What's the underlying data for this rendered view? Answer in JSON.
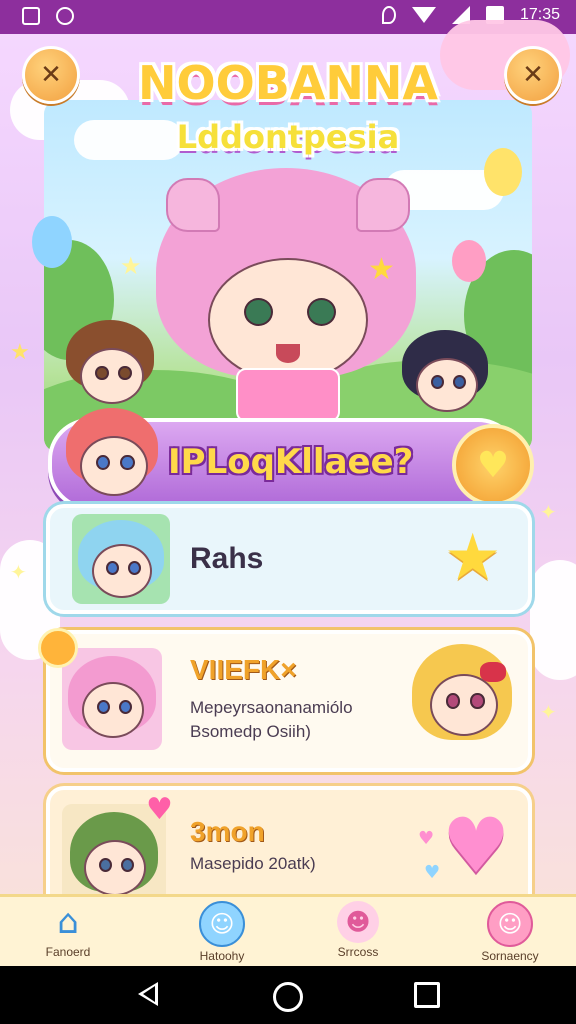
{
  "status_bar": {
    "time": "17:35"
  },
  "header": {
    "title": "NOOBANNA",
    "subtitle": "Lddontpesia"
  },
  "banner": {
    "text": "IPLoqKllaee?"
  },
  "cards": [
    {
      "title": "Rahs",
      "subtitle": ""
    },
    {
      "title": "VIIEFK×",
      "subtitle": "Mepeyrsaonanamiólo\nBsomedp Osiih)"
    },
    {
      "title": "3mon",
      "subtitle": "Masepido 20atk)"
    }
  ],
  "bottom_nav": [
    {
      "label": "Fanoerd",
      "icon": "home-icon"
    },
    {
      "label": "Hatoohy",
      "icon": "chat-face-icon"
    },
    {
      "label": "Srrcoss",
      "icon": "friends-icon"
    },
    {
      "label": "Sornaency",
      "icon": "profile-icon"
    }
  ],
  "colors": {
    "status_bar": "#8d2f9d",
    "title_yellow": "#ffcc3a",
    "banner_purple": "#b06ad8",
    "card1_border": "#9fd8ea",
    "card2_border": "#f2c36a",
    "nav_bg": "#fff3d4"
  }
}
